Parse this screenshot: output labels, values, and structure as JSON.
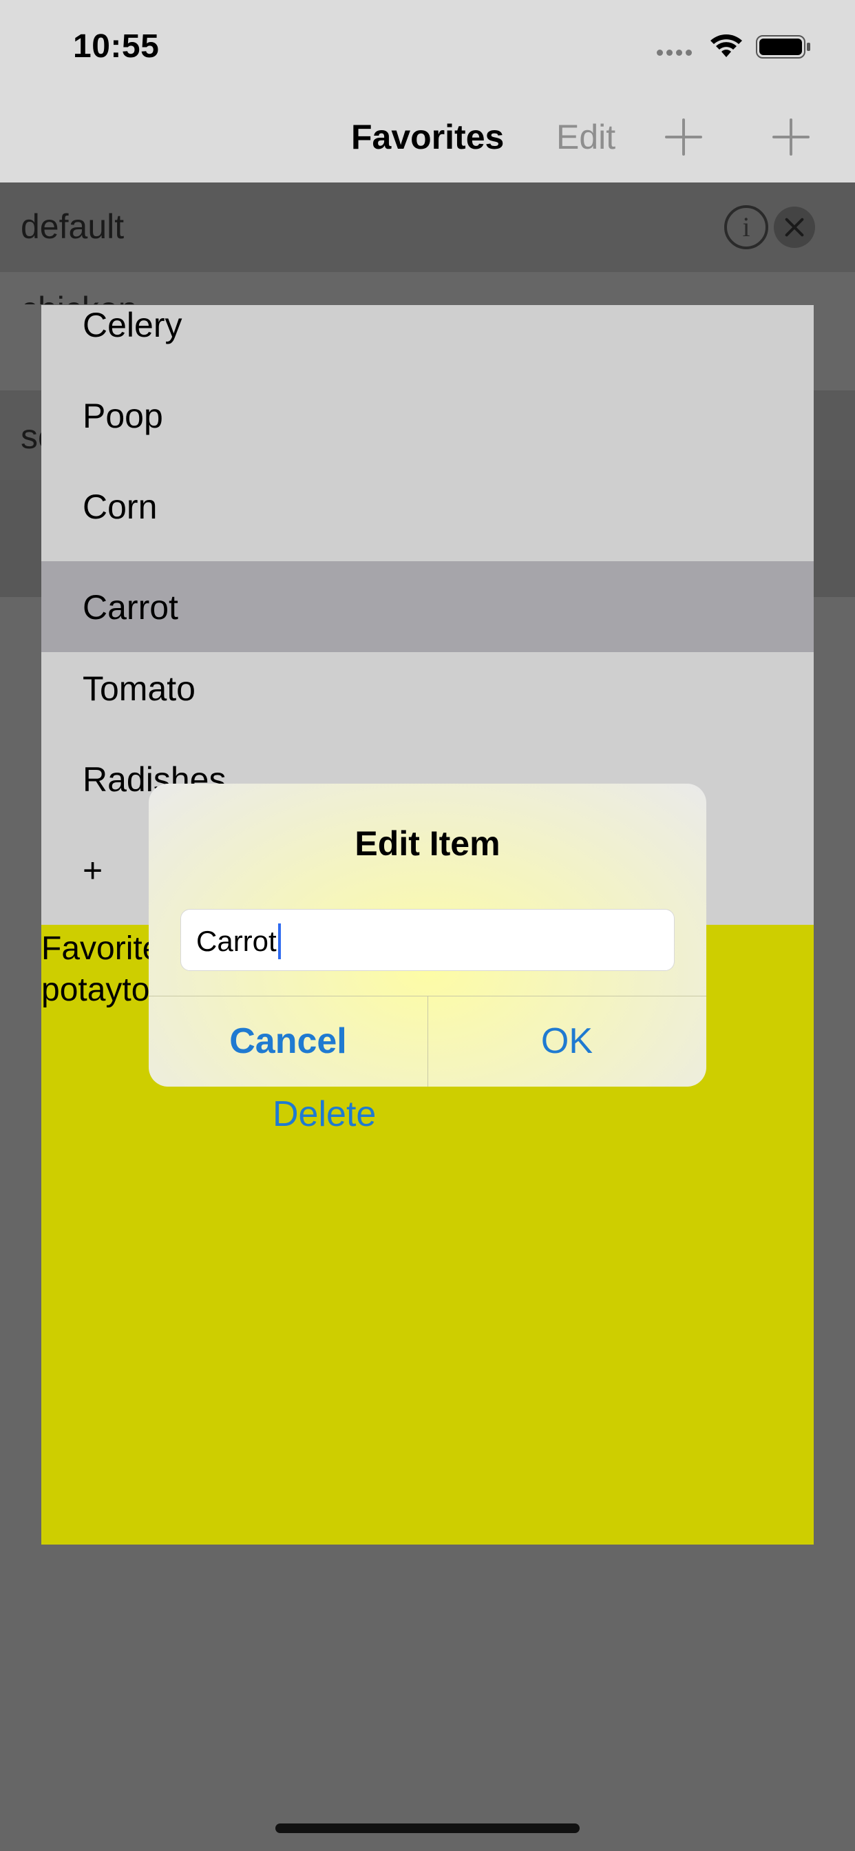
{
  "status_bar": {
    "time": "10:55",
    "icons": [
      "signal-dots-icon",
      "wifi-icon",
      "battery-icon"
    ]
  },
  "nav": {
    "title": "Favorites",
    "edit_label": "Edit",
    "add_icon": "plus-icon"
  },
  "background_list": {
    "rows": [
      {
        "label": "default"
      },
      {
        "label": "chicken"
      },
      {
        "label": "se"
      }
    ],
    "row_icons": [
      "info-icon",
      "close-icon"
    ]
  },
  "menu": {
    "items": [
      {
        "label": "Celery",
        "selected": false
      },
      {
        "label": "Poop",
        "selected": false
      },
      {
        "label": "Corn",
        "selected": false
      },
      {
        "label": "Carrot",
        "selected": true
      },
      {
        "label": "Tomato",
        "selected": false
      },
      {
        "label": "Radishes",
        "selected": false
      },
      {
        "label": "+",
        "selected": false
      }
    ]
  },
  "detail": {
    "line1": "Favorites",
    "line2": "potaytoes",
    "delete_label": "Delete"
  },
  "alert": {
    "title": "Edit Item",
    "input_value": "Carrot",
    "cancel_label": "Cancel",
    "ok_label": "OK"
  },
  "colors": {
    "accent": "#1f7ad1",
    "detail_background": "#cece00",
    "selected_row": "#a6a5aa",
    "dim_overlay": "#666666"
  }
}
